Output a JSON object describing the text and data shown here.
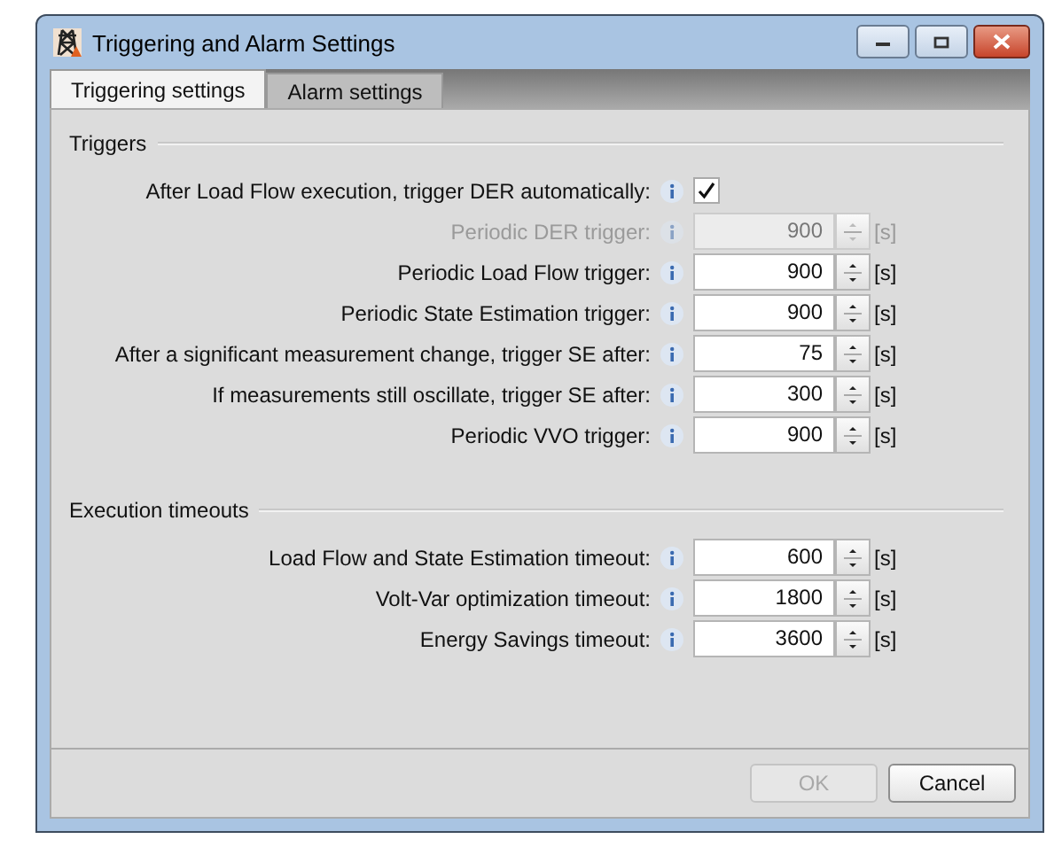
{
  "window": {
    "title": "Triggering and Alarm Settings"
  },
  "tabs": [
    {
      "label": "Triggering settings",
      "selected": true
    },
    {
      "label": "Alarm settings",
      "selected": false
    }
  ],
  "sections": [
    {
      "title": "Triggers",
      "rows": [
        {
          "kind": "checkbox",
          "label": "After Load Flow execution, trigger DER automatically:",
          "checked": true,
          "disabled": false
        },
        {
          "kind": "spin",
          "label": "Periodic DER trigger:",
          "value": "900",
          "unit": "[s]",
          "disabled": true
        },
        {
          "kind": "spin",
          "label": "Periodic Load Flow trigger:",
          "value": "900",
          "unit": "[s]",
          "disabled": false
        },
        {
          "kind": "spin",
          "label": "Periodic State Estimation trigger:",
          "value": "900",
          "unit": "[s]",
          "disabled": false
        },
        {
          "kind": "spin",
          "label": "After a significant measurement change, trigger SE after:",
          "value": "75",
          "unit": "[s]",
          "disabled": false
        },
        {
          "kind": "spin",
          "label": "If measurements still oscillate, trigger SE after:",
          "value": "300",
          "unit": "[s]",
          "disabled": false
        },
        {
          "kind": "spin",
          "label": "Periodic VVO trigger:",
          "value": "900",
          "unit": "[s]",
          "disabled": false
        }
      ]
    },
    {
      "title": "Execution timeouts",
      "rows": [
        {
          "kind": "spin",
          "label": "Load Flow and State Estimation timeout:",
          "value": "600",
          "unit": "[s]",
          "disabled": false
        },
        {
          "kind": "spin",
          "label": "Volt-Var optimization timeout:",
          "value": "1800",
          "unit": "[s]",
          "disabled": false
        },
        {
          "kind": "spin",
          "label": "Energy Savings timeout:",
          "value": "3600",
          "unit": "[s]",
          "disabled": false
        }
      ]
    }
  ],
  "buttons": [
    {
      "label": "OK",
      "disabled": true
    },
    {
      "label": "Cancel",
      "disabled": false
    }
  ]
}
